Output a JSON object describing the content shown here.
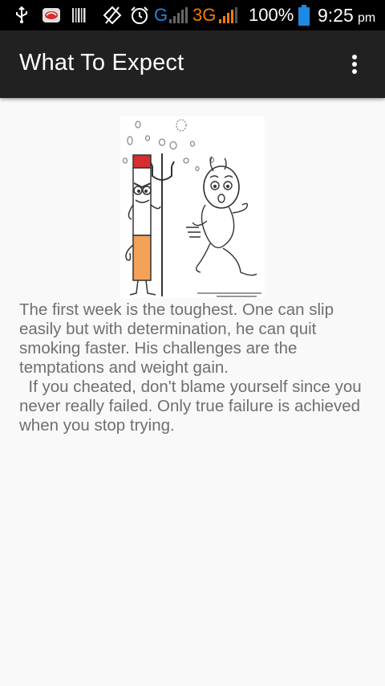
{
  "status_bar": {
    "network_g": "G",
    "network_3g": "3G",
    "battery": "100%",
    "time": "9:25",
    "ampm": "pm",
    "icons": [
      "usb-icon",
      "notification-icon",
      "barcode-icon",
      "signal-off-icon",
      "alarm-icon",
      "cell-signal-icon",
      "battery-icon"
    ],
    "accent_color": "#1e88e5",
    "signal_color": "#f57c00"
  },
  "app_bar": {
    "title": "What To Expect",
    "overflow_icon": "more-vert-icon"
  },
  "content": {
    "image_icon": "cigarette-devil-chasing-man-illustration",
    "paragraph_1": "The first week is the toughest. One can slip easily but with determination, he can quit smoking faster. His challenges are the temptations and weight gain.",
    "paragraph_2": "If you cheated, don't blame yourself since you never really failed. Only true failure is achieved when you stop trying."
  }
}
